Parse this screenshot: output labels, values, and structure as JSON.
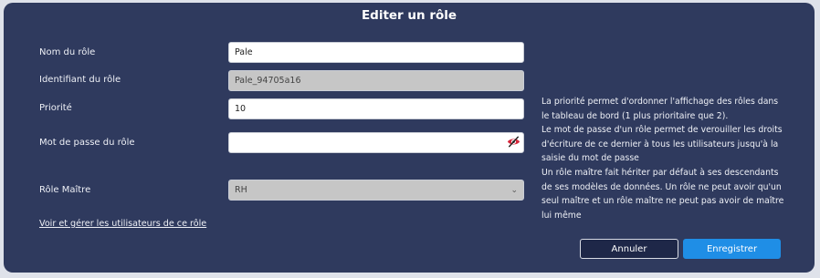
{
  "dialog": {
    "title": "Editer un rôle"
  },
  "form": {
    "name": {
      "label": "Nom du rôle",
      "value": "Pale"
    },
    "identifier": {
      "label": "Identifiant du rôle",
      "value": "Pale_94705a16"
    },
    "priority": {
      "label": "Priorité",
      "value": "10"
    },
    "password": {
      "label": "Mot de passe du rôle",
      "value": ""
    },
    "master_role": {
      "label": "Rôle Maître",
      "value": "RH"
    }
  },
  "help": {
    "line1": "La priorité permet d'ordonner l'affichage des rôles dans le tableau de bord (1 plus prioritaire que 2).",
    "line2": "Le mot de passe d'un rôle permet de verouiller les droits d'écriture de ce dernier à tous les utilisateurs jusqu'à la saisie du mot de passe",
    "line3": "Un rôle maître fait hériter par défaut à ses descendants de ses modèles de données. Un rôle ne peut avoir qu'un seul maître et un rôle maître ne peut pas avoir de maître lui même"
  },
  "links": {
    "manage_users": "Voir et gérer les utilisateurs de ce rôle"
  },
  "buttons": {
    "cancel": "Annuler",
    "save": "Enregistrer"
  },
  "icons": {
    "password_toggle": "eye-icon"
  },
  "colors": {
    "dialog_bg": "#2f3a5e",
    "primary": "#1f8ee6",
    "password_icon": "#d6263b"
  }
}
